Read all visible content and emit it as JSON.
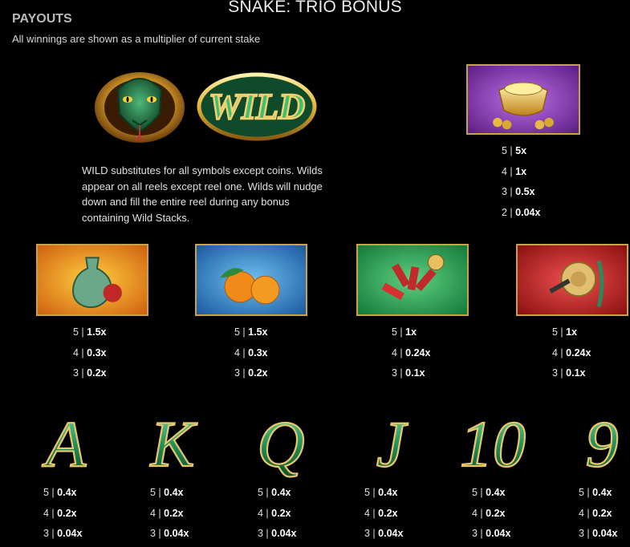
{
  "header": {
    "title": "SNAKE: TRIO BONUS",
    "section": "PAYOUTS",
    "subtitle": "All winnings are shown as a multiplier of current stake"
  },
  "wild": {
    "logo_text": "WILD",
    "description": "WILD substitutes for all symbols except coins. Wilds appear on all reels except reel one. Wilds will nudge down and fill the entire reel during any bonus containing Wild Stacks."
  },
  "gold_ingot": {
    "icon": "gold-ingot-icon",
    "payouts": [
      {
        "count": "5",
        "mult": "5x"
      },
      {
        "count": "4",
        "mult": "1x"
      },
      {
        "count": "3",
        "mult": "0.5x"
      },
      {
        "count": "2",
        "mult": "0.04x"
      }
    ]
  },
  "high_symbols": [
    {
      "icon": "vase-icon",
      "payouts": [
        {
          "count": "5",
          "mult": "1.5x"
        },
        {
          "count": "4",
          "mult": "0.3x"
        },
        {
          "count": "3",
          "mult": "0.2x"
        }
      ]
    },
    {
      "icon": "oranges-icon",
      "payouts": [
        {
          "count": "5",
          "mult": "1.5x"
        },
        {
          "count": "4",
          "mult": "0.3x"
        },
        {
          "count": "3",
          "mult": "0.2x"
        }
      ]
    },
    {
      "icon": "firecrackers-icon",
      "payouts": [
        {
          "count": "5",
          "mult": "1x"
        },
        {
          "count": "4",
          "mult": "0.24x"
        },
        {
          "count": "3",
          "mult": "0.1x"
        }
      ]
    },
    {
      "icon": "gong-icon",
      "payouts": [
        {
          "count": "5",
          "mult": "1x"
        },
        {
          "count": "4",
          "mult": "0.24x"
        },
        {
          "count": "3",
          "mult": "0.1x"
        }
      ]
    }
  ],
  "low_symbols": [
    {
      "glyph": "A",
      "icon": "letter-a-icon",
      "payouts": [
        {
          "count": "5",
          "mult": "0.4x"
        },
        {
          "count": "4",
          "mult": "0.2x"
        },
        {
          "count": "3",
          "mult": "0.04x"
        }
      ]
    },
    {
      "glyph": "K",
      "icon": "letter-k-icon",
      "payouts": [
        {
          "count": "5",
          "mult": "0.4x"
        },
        {
          "count": "4",
          "mult": "0.2x"
        },
        {
          "count": "3",
          "mult": "0.04x"
        }
      ]
    },
    {
      "glyph": "Q",
      "icon": "letter-q-icon",
      "payouts": [
        {
          "count": "5",
          "mult": "0.4x"
        },
        {
          "count": "4",
          "mult": "0.2x"
        },
        {
          "count": "3",
          "mult": "0.04x"
        }
      ]
    },
    {
      "glyph": "J",
      "icon": "letter-j-icon",
      "payouts": [
        {
          "count": "5",
          "mult": "0.4x"
        },
        {
          "count": "4",
          "mult": "0.2x"
        },
        {
          "count": "3",
          "mult": "0.04x"
        }
      ]
    },
    {
      "glyph": "10",
      "icon": "number-10-icon",
      "payouts": [
        {
          "count": "5",
          "mult": "0.4x"
        },
        {
          "count": "4",
          "mult": "0.2x"
        },
        {
          "count": "3",
          "mult": "0.04x"
        }
      ]
    },
    {
      "glyph": "9",
      "icon": "number-9-icon",
      "payouts": [
        {
          "count": "5",
          "mult": "0.4x"
        },
        {
          "count": "4",
          "mult": "0.2x"
        },
        {
          "count": "3",
          "mult": "0.04x"
        }
      ]
    }
  ],
  "colors": {
    "frame_gold": "#c9a24c",
    "jade": "#2f8a5a",
    "purple": "#8a3db0",
    "orange": "#f0a020",
    "blue": "#2f7ac0",
    "green": "#2aa050",
    "red": "#c02a2a"
  }
}
